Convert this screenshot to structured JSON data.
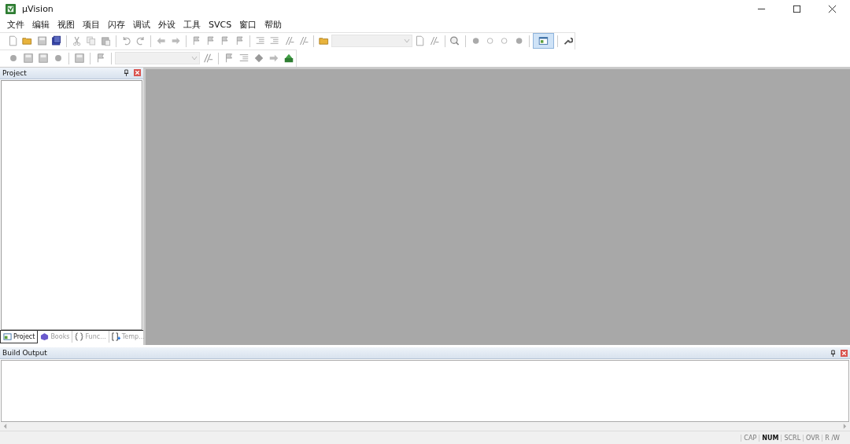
{
  "window": {
    "title": "µVision"
  },
  "menu": [
    "文件",
    "编辑",
    "视图",
    "项目",
    "闪存",
    "调试",
    "外设",
    "工具",
    "SVCS",
    "窗口",
    "帮助"
  ],
  "project_panel": {
    "title": "Project",
    "tabs": [
      {
        "label": "Project",
        "selected": true
      },
      {
        "label": "Books",
        "selected": false
      },
      {
        "label": "Func...",
        "selected": false
      },
      {
        "label": "Temp...",
        "selected": false
      }
    ]
  },
  "build_output": {
    "title": "Build Output"
  },
  "status_bar": {
    "indicators": [
      {
        "label": "CAP",
        "on": false
      },
      {
        "label": "NUM",
        "on": true
      },
      {
        "label": "SCRL",
        "on": false
      },
      {
        "label": "OVR",
        "on": false
      },
      {
        "label": "R /W",
        "on": false
      }
    ]
  }
}
